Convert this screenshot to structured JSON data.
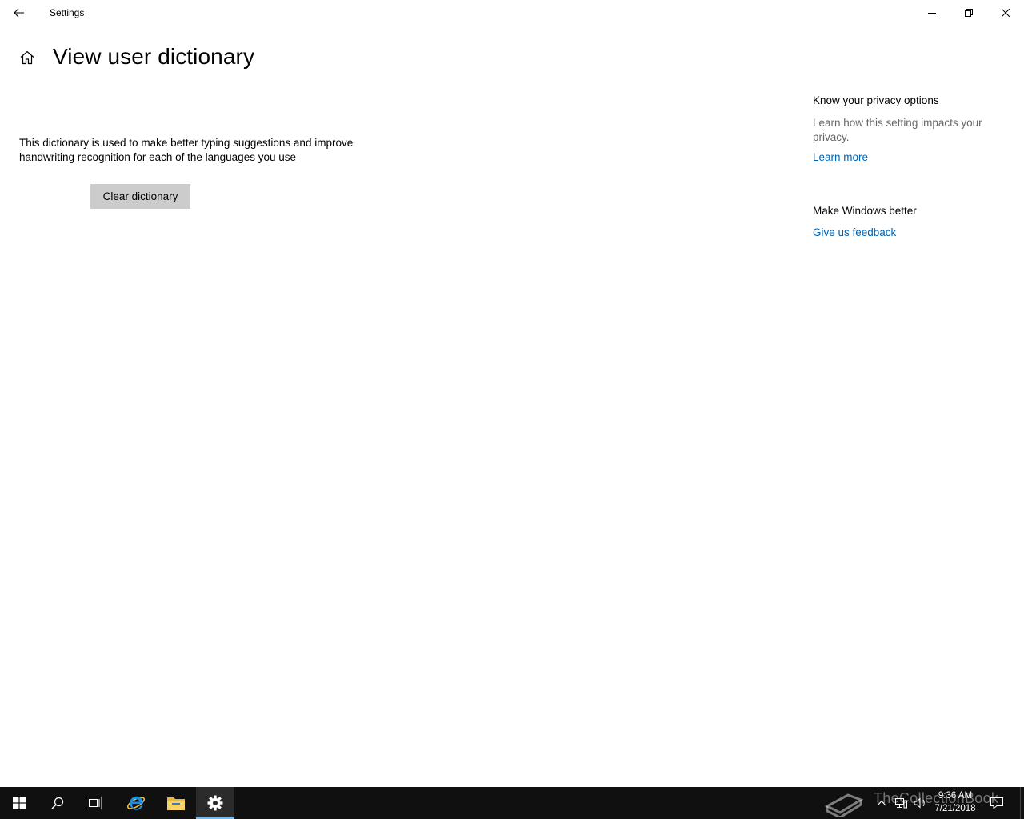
{
  "window": {
    "title": "Settings",
    "back_icon": "back-arrow-icon",
    "controls": {
      "minimize": "minimize-icon",
      "maximize": "restore-icon",
      "close": "close-icon"
    }
  },
  "header": {
    "home_icon": "home-icon",
    "title": "View user dictionary"
  },
  "main": {
    "description": "This dictionary is used to make better typing suggestions and improve handwriting recognition for each of the languages you use",
    "clear_button": "Clear dictionary"
  },
  "side": {
    "privacy_heading": "Know your privacy options",
    "privacy_text": "Learn how this setting impacts your privacy.",
    "learn_more": "Learn more",
    "feedback_heading": "Make Windows better",
    "feedback_link": "Give us feedback"
  },
  "taskbar": {
    "items": [
      "start-icon",
      "search-icon",
      "task-view-icon",
      "internet-explorer-icon",
      "file-explorer-icon",
      "settings-gear-icon"
    ],
    "active_item": "settings-gear-icon",
    "tray": [
      "chevron-up-icon",
      "network-icon",
      "volume-icon",
      "action-center-icon"
    ],
    "time": "9:36 AM",
    "date": "7/21/2018",
    "watermark": "TheCollectionBook"
  },
  "colors": {
    "link": "#0063b1",
    "button_bg": "#cccccc",
    "taskbar_bg": "#101010",
    "active_indicator": "#76b9ed",
    "secondary_text": "#666666"
  }
}
